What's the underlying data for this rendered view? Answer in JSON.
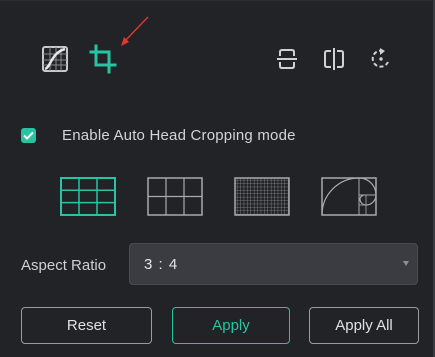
{
  "toolbar": {
    "tools": [
      {
        "icon": "adjust-icon",
        "active": false
      },
      {
        "icon": "crop-icon",
        "active": true
      },
      {
        "icon": "flip-vertical-icon",
        "active": false
      },
      {
        "icon": "flip-horizontal-icon",
        "active": false
      },
      {
        "icon": "rotate-icon",
        "active": false
      }
    ]
  },
  "auto_crop": {
    "label": "Enable Auto Head Cropping mode",
    "checked": true
  },
  "grid_options": [
    {
      "name": "grid-3x3",
      "selected": true
    },
    {
      "name": "grid-2x3",
      "selected": false
    },
    {
      "name": "grid-fine",
      "selected": false
    },
    {
      "name": "grid-golden-spiral",
      "selected": false
    }
  ],
  "aspect_ratio": {
    "label": "Aspect Ratio",
    "value": "3 : 4"
  },
  "buttons": {
    "reset": "Reset",
    "apply": "Apply",
    "apply_all": "Apply All"
  },
  "colors": {
    "background": "#222327",
    "accent": "#27c3a3",
    "text": "#d3d4d6",
    "select_bg": "#3b3c41",
    "annotation_arrow": "#e03a2f"
  }
}
